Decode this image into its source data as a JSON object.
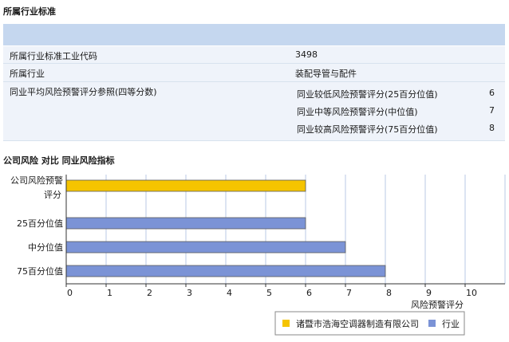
{
  "section1": {
    "title": "所属行业标准",
    "rows": [
      {
        "label": "所属行业标准工业代码",
        "value": "3498"
      },
      {
        "label": "所属行业",
        "value": "装配导管与配件"
      }
    ],
    "avg": {
      "label": "同业平均风险预警评分参照(四等分数)",
      "items": [
        {
          "label": "同业较低风险预警评分(25百分位值)",
          "value": "6"
        },
        {
          "label": "同业中等风险预警评分(中位值)",
          "value": "7"
        },
        {
          "label": "同业较高风险预警评分(75百分位值)",
          "value": "8"
        }
      ]
    }
  },
  "section2": {
    "title": "公司风险 对比 同业风险指标"
  },
  "chart_data": {
    "type": "bar",
    "orientation": "horizontal",
    "categories": [
      "公司风险预警评分",
      "25百分位值",
      "中分位值",
      "75百分位值"
    ],
    "category_label_lines": [
      [
        "公司风险预警",
        "评分"
      ],
      [
        "25百分位值"
      ],
      [
        "中分位值"
      ],
      [
        "75百分位值"
      ]
    ],
    "values": [
      6,
      6,
      7,
      8
    ],
    "series_of_bar": [
      0,
      1,
      1,
      1
    ],
    "series": [
      {
        "name": "诸暨市浩海空调器制造有限公司",
        "color": "#f5c400"
      },
      {
        "name": "行业",
        "color": "#7b93d6"
      }
    ],
    "xlabel": "风险预警评分",
    "xlim": [
      0,
      11
    ],
    "xticks": [
      0,
      1,
      2,
      3,
      4,
      5,
      6,
      7,
      8,
      9,
      10
    ],
    "grid": true,
    "legend_position": "bottom-right"
  }
}
